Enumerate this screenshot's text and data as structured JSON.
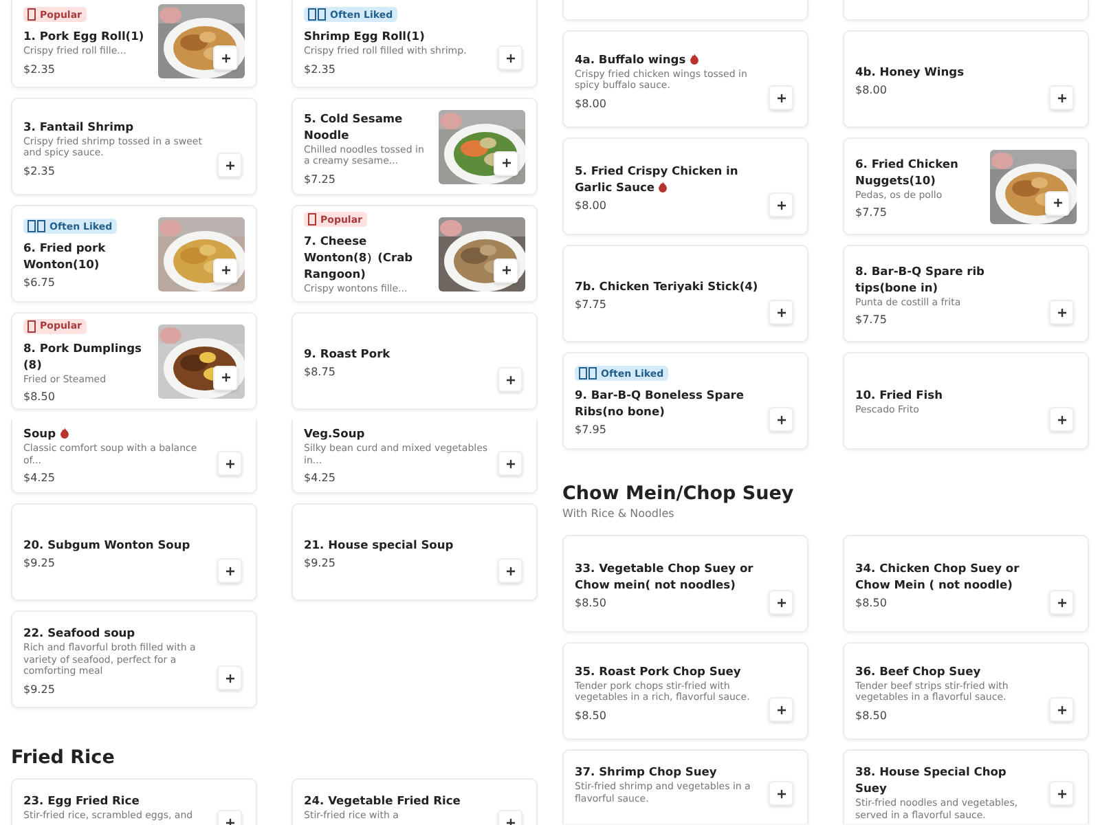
{
  "halves": [
    {
      "blocks": [
        {
          "kind": "row",
          "items": [
            {
              "title": "1. Pork Egg Roll(1)",
              "spicy": false,
              "badge": {
                "kind": "popular",
                "label": "Popular"
              },
              "description": "Crispy fried roll fille...",
              "price": "$2.35"
            },
            {
              "title": "Shrimp Egg Roll(1)",
              "spicy": false,
              "badge": {
                "kind": "often-liked",
                "label": "Often Liked"
              },
              "description": "Crispy fried roll filled with shrimp.",
              "price": "$2.35"
            }
          ]
        },
        {
          "kind": "row",
          "items": [
            {
              "title": "3. Fantail Shrimp",
              "spicy": false,
              "description": "Crispy fried shrimp tossed in a sweet and spicy sauce.",
              "price": "$2.35"
            },
            {
              "title": "5. Cold Sesame Noodle",
              "spicy": false,
              "description": "Chilled noodles tossed in a creamy sesame...",
              "price": "$7.25"
            }
          ]
        },
        {
          "kind": "row",
          "items": [
            {
              "title": "6. Fried pork Wonton(10)",
              "spicy": false,
              "badge": {
                "kind": "often-liked",
                "label": "Often Liked"
              },
              "price": "$6.75"
            },
            {
              "title": "7. Cheese Wonton(8）(Crab Rangoon)",
              "spicy": false,
              "badge": {
                "kind": "popular",
                "label": "Popular"
              },
              "description": "Crispy wontons fille..."
            }
          ]
        },
        {
          "kind": "row",
          "items": [
            {
              "title": "8. Pork Dumplings (8)",
              "spicy": false,
              "badge": {
                "kind": "popular",
                "label": "Popular"
              },
              "description": "Fried or Steamed",
              "price": "$8.50"
            },
            {
              "title": "9. Roast Pork",
              "spicy": false,
              "price": "$8.75"
            }
          ]
        },
        {
          "kind": "cut-row",
          "items": [
            {
              "title": "Soup",
              "spicy": true,
              "description": "Classic comfort soup with a balance of...",
              "price": "$4.25"
            },
            {
              "title": "Veg.Soup",
              "spicy": false,
              "description": "Silky bean curd and mixed vegetables in...",
              "price": "$4.25"
            }
          ]
        },
        {
          "kind": "row",
          "items": [
            {
              "title": "20. Subgum Wonton Soup",
              "spicy": false,
              "price": "$9.25"
            },
            {
              "title": "21. House special Soup",
              "spicy": false,
              "price": "$9.25"
            }
          ]
        },
        {
          "kind": "row",
          "items": [
            {
              "title": "22. Seafood soup",
              "spicy": false,
              "description": "Rich and flavorful broth filled with a variety of seafood, perfect for a comforting meal",
              "price": "$9.25"
            }
          ]
        },
        {
          "kind": "heading",
          "title": "Fried Rice"
        },
        {
          "kind": "end-row",
          "items": [
            {
              "title": "23. Egg Fried Rice",
              "spicy": false,
              "description": "Stir-fried rice, scrambled eggs, and"
            },
            {
              "title": "24. Vegetable Fried Rice",
              "spicy": false,
              "description": "Stir-fried rice with a"
            }
          ]
        }
      ]
    },
    {
      "blocks": [
        {
          "kind": "stub"
        },
        {
          "kind": "row",
          "items": [
            {
              "title": "4a. Buffalo wings",
              "spicy": true,
              "description": "Crispy fried chicken wings tossed in spicy buffalo sauce.",
              "price": "$8.00"
            },
            {
              "title": "4b. Honey Wings",
              "spicy": false,
              "price": "$8.00"
            }
          ]
        },
        {
          "kind": "row",
          "items": [
            {
              "title": "5. Fried Crispy Chicken in Garlic Sauce",
              "spicy": true,
              "price": "$8.00"
            },
            {
              "title": "6. Fried Chicken Nuggets(10)",
              "spicy": false,
              "description": "Pedas, os de pollo",
              "price": "$7.75"
            }
          ]
        },
        {
          "kind": "row",
          "items": [
            {
              "title": "7b. Chicken Teriyaki Stick(4)",
              "spicy": false,
              "price": "$7.75"
            },
            {
              "title": "8. Bar-B-Q Spare rib tips(bone in)",
              "spicy": false,
              "description": "Punta de costill a frita",
              "price": "$7.75"
            }
          ]
        },
        {
          "kind": "row",
          "items": [
            {
              "title": "9. Bar-B-Q Boneless Spare Ribs(no bone)",
              "spicy": false,
              "badge": {
                "kind": "often-liked",
                "label": "Often Liked"
              },
              "price": "$7.95"
            },
            {
              "title": "10. Fried Fish",
              "spicy": false,
              "description": "Pescado Frito"
            }
          ]
        },
        {
          "kind": "heading",
          "title": "Chow Mein/Chop Suey",
          "subtitle": "With Rice & Noodles"
        },
        {
          "kind": "row",
          "items": [
            {
              "title": "33. Vegetable Chop Suey or Chow mein( not noodles)",
              "spicy": false,
              "price": "$8.50"
            },
            {
              "title": "34. Chicken Chop Suey or Chow Mein ( not noodle)",
              "spicy": false,
              "price": "$8.50"
            }
          ]
        },
        {
          "kind": "row",
          "items": [
            {
              "title": "35. Roast Pork Chop Suey",
              "spicy": false,
              "description": "Tender pork chops stir-fried with vegetables in a rich, flavorful sauce.",
              "price": "$8.50"
            },
            {
              "title": "36. Beef Chop Suey",
              "spicy": false,
              "description": "Tender beef strips stir-fried with vegetables in a flavorful sauce.",
              "price": "$8.50"
            }
          ]
        },
        {
          "kind": "end-row",
          "items": [
            {
              "title": "37. Shrimp Chop Suey",
              "spicy": false,
              "description": "Stir-fried shrimp and vegetables in a flavorful sauce."
            },
            {
              "title": "38. House Special Chop Suey",
              "spicy": false,
              "description": "Stir-fried noodles and vegetables, served in a flavorful sauce."
            }
          ]
        }
      ]
    }
  ]
}
